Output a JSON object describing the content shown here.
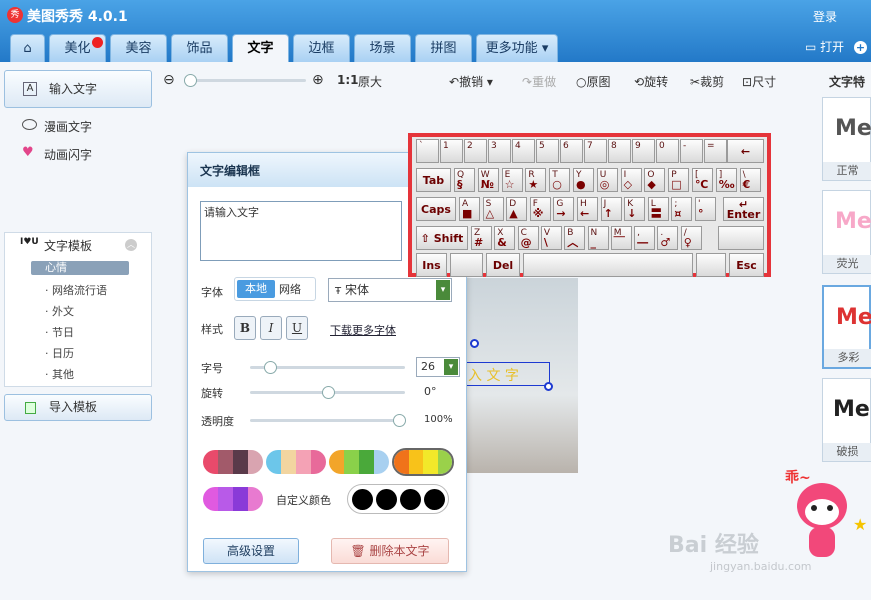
{
  "app": {
    "title": "美图秀秀 4.0.1",
    "logo_text": "秀",
    "login": "登录",
    "open": "打开"
  },
  "tabs": [
    {
      "label": "美化"
    },
    {
      "label": "美容"
    },
    {
      "label": "饰品"
    },
    {
      "label": "文字"
    },
    {
      "label": "边框"
    },
    {
      "label": "场景"
    },
    {
      "label": "拼图"
    },
    {
      "label": "更多功能"
    }
  ],
  "sidebar": {
    "input_text": "输入文字",
    "comic_text": "漫画文字",
    "anim_text": "动画闪字",
    "template": "文字模板",
    "subs": [
      "心情",
      "网络流行语",
      "外文",
      "节日",
      "日历",
      "其他"
    ],
    "import": "导入模板"
  },
  "toolbar": {
    "zoom_label": "1:1",
    "original_size": "原大",
    "undo": "撤销",
    "redo": "重做",
    "original": "原图",
    "rotate": "旋转",
    "crop": "裁剪",
    "size": "尺寸"
  },
  "right_panel": {
    "title": "文字特",
    "thumbs": [
      {
        "sample": "Me",
        "cap": "正常",
        "color": "#555"
      },
      {
        "sample": "Me",
        "cap": "荧光",
        "color": "#f7a8c8"
      },
      {
        "sample": "Me",
        "cap": "多彩",
        "color": "#d33"
      },
      {
        "sample": "Mei",
        "cap": "破损",
        "color": "#222"
      }
    ]
  },
  "editor": {
    "title": "文字编辑框",
    "placeholder": "请输入文字",
    "font_label": "字体",
    "font_local": "本地",
    "font_net": "网络",
    "font_name": "宋体",
    "style_label": "样式",
    "bold": "B",
    "italic": "I",
    "underline": "U",
    "more_fonts": "下载更多字体",
    "size_label": "字号",
    "size_value": "26",
    "rotate_label": "旋转",
    "rotate_value": "0°",
    "opacity_label": "透明度",
    "opacity_value": "100%",
    "custom_color": "自定义颜色",
    "advanced": "高级设置",
    "delete": "删除本文字"
  },
  "canvas_text": "入 文 字",
  "keyboard": {
    "row1": [
      [
        "`",
        ""
      ],
      [
        "1",
        ""
      ],
      [
        "2",
        ""
      ],
      [
        "3",
        ""
      ],
      [
        "4",
        ""
      ],
      [
        "5",
        ""
      ],
      [
        "6",
        ""
      ],
      [
        "7",
        ""
      ],
      [
        "8",
        ""
      ],
      [
        "9",
        ""
      ],
      [
        "0",
        ""
      ],
      [
        "-",
        ""
      ],
      [
        "=",
        ""
      ]
    ],
    "row2": [
      [
        "Q",
        "§"
      ],
      [
        "W",
        "№"
      ],
      [
        "E",
        "☆"
      ],
      [
        "R",
        "★"
      ],
      [
        "T",
        "○"
      ],
      [
        "Y",
        "●"
      ],
      [
        "U",
        "◎"
      ],
      [
        "I",
        "◇"
      ],
      [
        "O",
        "◆"
      ],
      [
        "P",
        "□"
      ],
      [
        "[",
        "℃"
      ],
      [
        "]",
        "‰"
      ],
      [
        "\\",
        "€"
      ]
    ],
    "row3": [
      [
        "A",
        "■"
      ],
      [
        "S",
        "△"
      ],
      [
        "D",
        "▲"
      ],
      [
        "F",
        "※"
      ],
      [
        "G",
        "→"
      ],
      [
        "H",
        "←"
      ],
      [
        "J",
        "↑"
      ],
      [
        "K",
        "↓"
      ],
      [
        "L",
        "〓"
      ],
      [
        ";",
        "¤"
      ],
      [
        "'",
        "°"
      ]
    ],
    "row4": [
      [
        "Z",
        "#"
      ],
      [
        "X",
        "&"
      ],
      [
        "C",
        "@"
      ],
      [
        "V",
        "\\"
      ],
      [
        "B",
        "︿"
      ],
      [
        "N",
        "_"
      ],
      [
        "M",
        "￣"
      ],
      [
        ",",
        "―"
      ],
      [
        ".",
        "♂"
      ],
      [
        "/",
        "♀"
      ]
    ],
    "tab": "Tab",
    "caps": "Caps",
    "shift": "Shift",
    "enter": "Enter",
    "ins": "Ins",
    "del": "Del",
    "esc": "Esc",
    "back": "←"
  },
  "watermark": {
    "baidu": "Bai 经验",
    "url": "jingyan.baidu.com",
    "mascot_text": "乖~"
  }
}
